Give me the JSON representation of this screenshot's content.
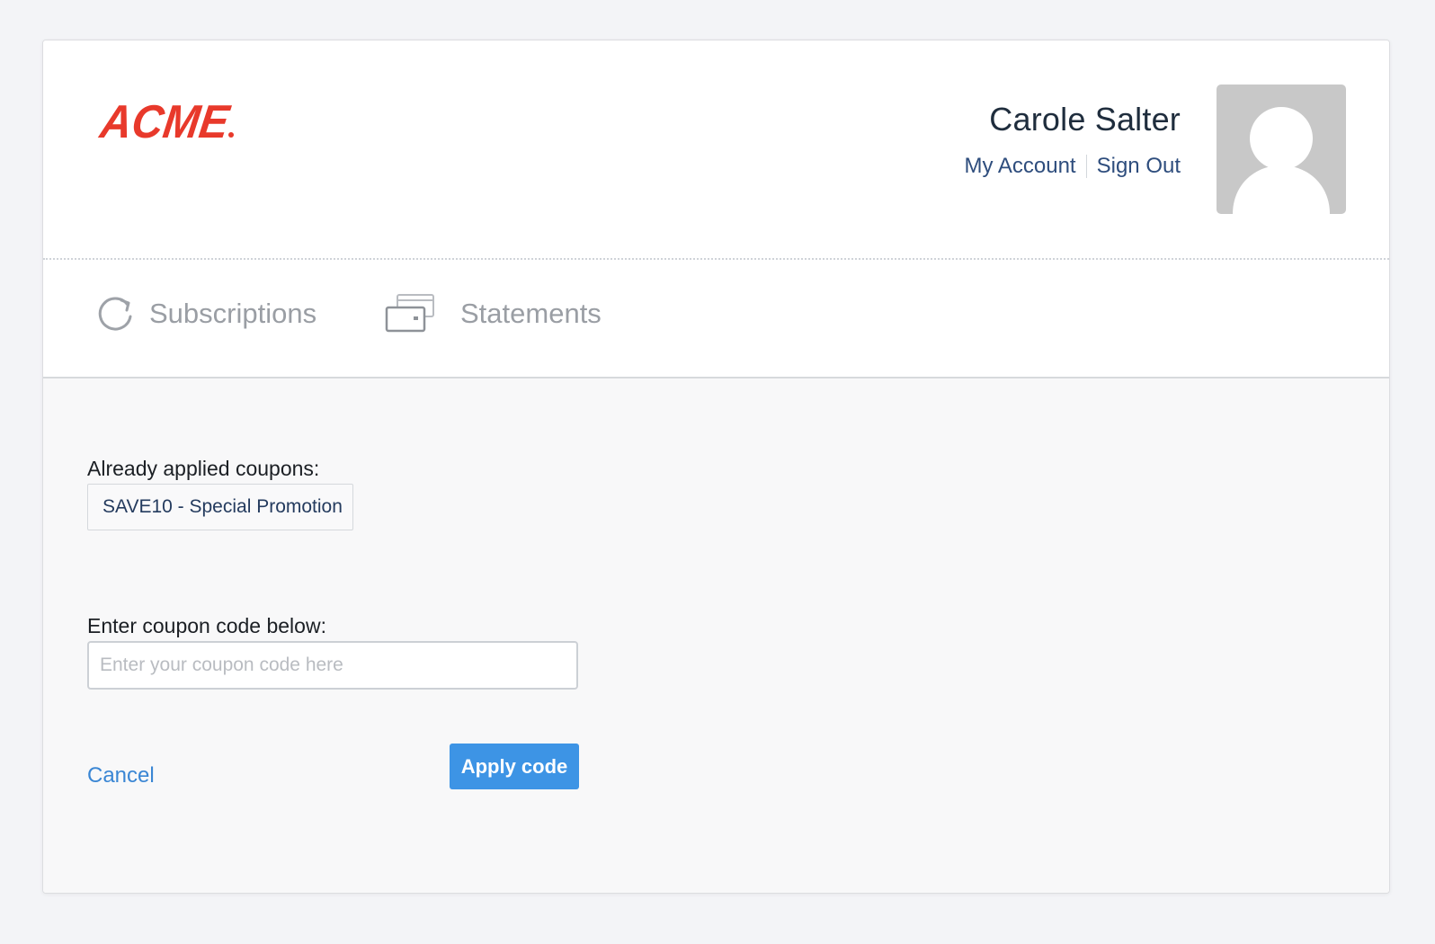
{
  "brand": {
    "logo_text": "ACME",
    "logo_color": "#e8392b"
  },
  "user": {
    "name": "Carole Salter",
    "my_account_label": "My Account",
    "sign_out_label": "Sign Out",
    "avatar_icon": "user-silhouette-icon"
  },
  "nav": {
    "items": [
      {
        "label": "Subscriptions",
        "icon": "refresh-icon"
      },
      {
        "label": "Statements",
        "icon": "cards-icon"
      }
    ]
  },
  "coupons": {
    "applied_label": "Already applied coupons:",
    "applied": [
      {
        "text": "SAVE10 - Special Promotion"
      }
    ],
    "enter_label": "Enter coupon code below:",
    "input_placeholder": "Enter your coupon code here",
    "input_value": "",
    "cancel_label": "Cancel",
    "apply_label": "Apply code"
  },
  "colors": {
    "accent": "#3d94e5",
    "link": "#3a86d4",
    "user_link": "#2e4d7d",
    "nav_text": "#9a9ea4"
  }
}
